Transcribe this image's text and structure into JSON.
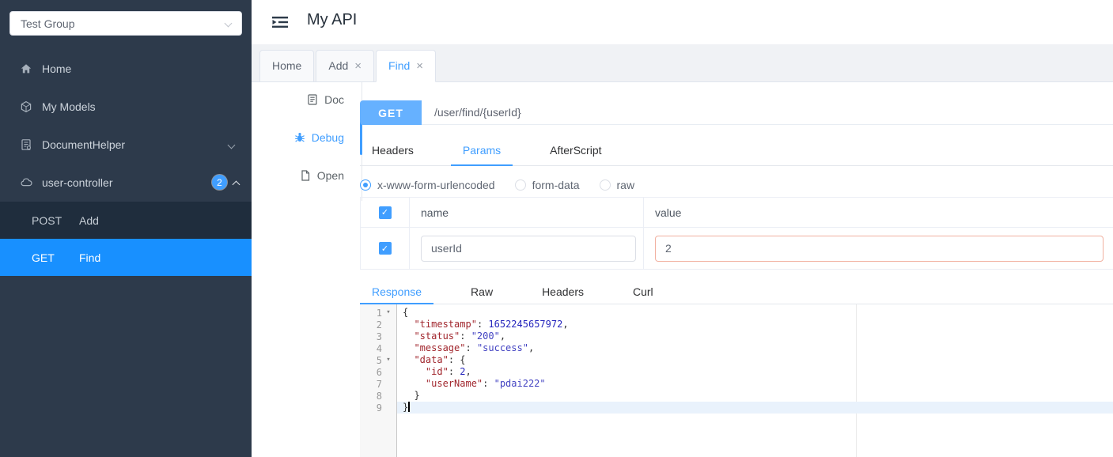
{
  "colors": {
    "accent": "#409eff",
    "active_submenu": "#1890ff",
    "method_button": "#66b1ff",
    "sidebar_bg": "#2d3a4b",
    "submenu_bg": "#1f2d3d",
    "value_input_border": "#f1b0a0",
    "active_line_bg": "#e9f2fc"
  },
  "sidebar": {
    "group_select": {
      "value": "Test Group"
    },
    "items": [
      {
        "icon": "home-icon",
        "label": "Home"
      },
      {
        "icon": "models-icon",
        "label": "My Models"
      },
      {
        "icon": "document-icon",
        "label": "DocumentHelper",
        "chevron": "down"
      },
      {
        "icon": "cloud-icon",
        "label": "user-controller",
        "badge": "2",
        "chevron": "up"
      }
    ],
    "submenu": [
      {
        "method": "POST",
        "label": "Add",
        "active": false
      },
      {
        "method": "GET",
        "label": "Find",
        "active": true
      }
    ]
  },
  "header": {
    "title": "My API"
  },
  "page_tabs": [
    {
      "label": "Home",
      "closable": false,
      "active": false
    },
    {
      "label": "Add",
      "closable": true,
      "active": false
    },
    {
      "label": "Find",
      "closable": true,
      "active": true
    }
  ],
  "side_tabs": [
    {
      "icon": "doc-icon",
      "label": "Doc",
      "active": false
    },
    {
      "icon": "bug-icon",
      "label": "Debug",
      "active": true
    },
    {
      "icon": "open-icon",
      "label": "Open",
      "active": false
    }
  ],
  "request": {
    "method": "GET",
    "url": "/user/find/{userId}"
  },
  "param_tabs": [
    {
      "label": "Headers",
      "active": false
    },
    {
      "label": "Params",
      "active": true
    },
    {
      "label": "AfterScript",
      "active": false
    }
  ],
  "body_types": [
    {
      "label": "x-www-form-urlencoded",
      "selected": true
    },
    {
      "label": "form-data",
      "selected": false
    },
    {
      "label": "raw",
      "selected": false
    }
  ],
  "params_table": {
    "columns": {
      "name": "name",
      "value": "value"
    },
    "header_checked": true,
    "rows": [
      {
        "checked": true,
        "name": "userId",
        "value": "2"
      }
    ]
  },
  "response_tabs": [
    {
      "label": "Response",
      "active": true
    },
    {
      "label": "Raw",
      "active": false
    },
    {
      "label": "Headers",
      "active": false
    },
    {
      "label": "Curl",
      "active": false
    }
  ],
  "editor": {
    "active_line": 9,
    "cursor_line": 9,
    "lines": [
      {
        "num": 1,
        "fold": true,
        "segments": [
          {
            "c": "p",
            "t": "{"
          }
        ]
      },
      {
        "num": 2,
        "fold": false,
        "segments": [
          {
            "c": "p",
            "t": "  "
          },
          {
            "c": "k",
            "t": "\"timestamp\""
          },
          {
            "c": "p",
            "t": ": "
          },
          {
            "c": "n",
            "t": "1652245657972"
          },
          {
            "c": "p",
            "t": ","
          }
        ]
      },
      {
        "num": 3,
        "fold": false,
        "segments": [
          {
            "c": "p",
            "t": "  "
          },
          {
            "c": "k",
            "t": "\"status\""
          },
          {
            "c": "p",
            "t": ": "
          },
          {
            "c": "s",
            "t": "\"200\""
          },
          {
            "c": "p",
            "t": ","
          }
        ]
      },
      {
        "num": 4,
        "fold": false,
        "segments": [
          {
            "c": "p",
            "t": "  "
          },
          {
            "c": "k",
            "t": "\"message\""
          },
          {
            "c": "p",
            "t": ": "
          },
          {
            "c": "s",
            "t": "\"success\""
          },
          {
            "c": "p",
            "t": ","
          }
        ]
      },
      {
        "num": 5,
        "fold": true,
        "segments": [
          {
            "c": "p",
            "t": "  "
          },
          {
            "c": "k",
            "t": "\"data\""
          },
          {
            "c": "p",
            "t": ": {"
          }
        ]
      },
      {
        "num": 6,
        "fold": false,
        "segments": [
          {
            "c": "p",
            "t": "    "
          },
          {
            "c": "k",
            "t": "\"id\""
          },
          {
            "c": "p",
            "t": ": "
          },
          {
            "c": "n",
            "t": "2"
          },
          {
            "c": "p",
            "t": ","
          }
        ]
      },
      {
        "num": 7,
        "fold": false,
        "segments": [
          {
            "c": "p",
            "t": "    "
          },
          {
            "c": "k",
            "t": "\"userName\""
          },
          {
            "c": "p",
            "t": ": "
          },
          {
            "c": "s",
            "t": "\"pdai222\""
          }
        ]
      },
      {
        "num": 8,
        "fold": false,
        "segments": [
          {
            "c": "p",
            "t": "  }"
          }
        ]
      },
      {
        "num": 9,
        "fold": false,
        "segments": [
          {
            "c": "p",
            "t": "}"
          }
        ]
      }
    ]
  }
}
